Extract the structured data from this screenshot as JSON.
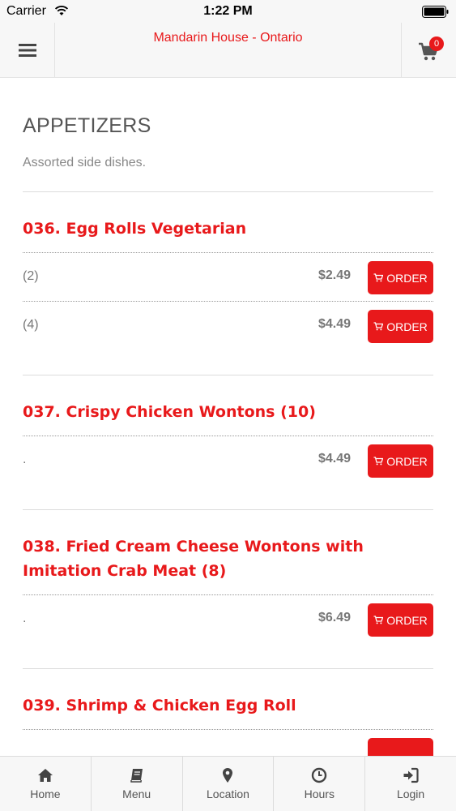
{
  "status_bar": {
    "carrier": "Carrier",
    "time": "1:22 PM"
  },
  "header": {
    "title": "Mandarin House - Ontario",
    "cart_count": "0"
  },
  "section": {
    "title": "APPETIZERS",
    "description": "Assorted side dishes."
  },
  "items": [
    {
      "name": "036. Egg Rolls Vegetarian",
      "options": [
        {
          "label": "(2)",
          "price": "$2.49",
          "button": "ORDER"
        },
        {
          "label": "(4)",
          "price": "$4.49",
          "button": "ORDER"
        }
      ]
    },
    {
      "name": "037. Crispy Chicken Wontons (10)",
      "options": [
        {
          "label": ".",
          "price": "$4.49",
          "button": "ORDER"
        }
      ]
    },
    {
      "name": "038. Fried Cream Cheese Wontons with Imitation Crab Meat (8)",
      "options": [
        {
          "label": ".",
          "price": "$6.49",
          "button": "ORDER"
        }
      ]
    },
    {
      "name": "039. Shrimp & Chicken Egg Roll",
      "options": [
        {
          "label": "",
          "price": "",
          "button": ""
        }
      ]
    }
  ],
  "tabs": [
    {
      "label": "Home",
      "icon": "home-icon"
    },
    {
      "label": "Menu",
      "icon": "book-icon"
    },
    {
      "label": "Location",
      "icon": "map-pin-icon"
    },
    {
      "label": "Hours",
      "icon": "clock-icon"
    },
    {
      "label": "Login",
      "icon": "login-icon"
    }
  ],
  "colors": {
    "accent": "#e8191b",
    "bar_bg": "#f7f7f7"
  }
}
